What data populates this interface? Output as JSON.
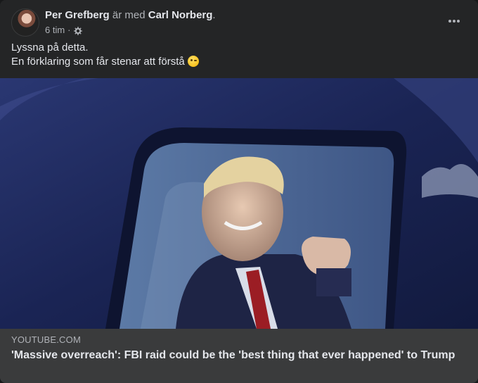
{
  "post": {
    "author": "Per Grefberg",
    "with_text": " är med ",
    "tagged": "Carl Norberg",
    "period": ".",
    "time": "6 tim",
    "separator": "·",
    "privacy_icon": "gear-icon",
    "text_line1": "Lyssna på detta.",
    "text_line2": "En förklaring som får stenar att förstå",
    "emoji": "smirking-face-emoji"
  },
  "link": {
    "domain": "YOUTUBE.COM",
    "title": "'Massive overreach': FBI raid could be the 'best thing that ever happened' to Trump"
  },
  "colors": {
    "card_bg": "#242526",
    "caption_bg": "#3a3b3c",
    "primary_text": "#e4e6eb",
    "secondary_text": "#b0b3b8"
  }
}
